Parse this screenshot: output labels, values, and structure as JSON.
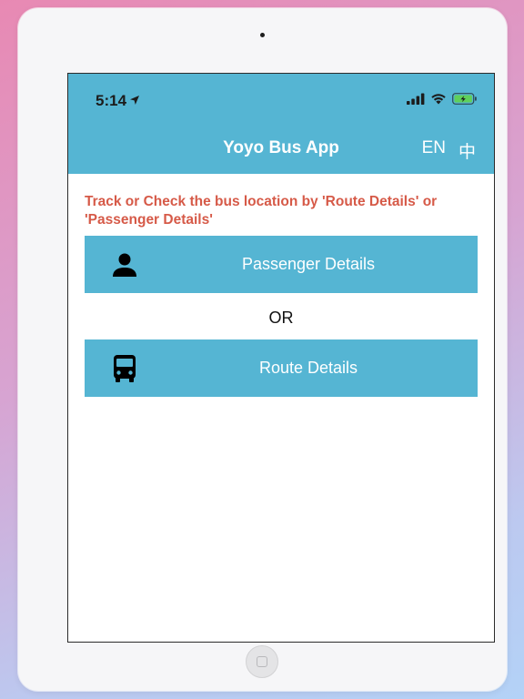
{
  "status_bar": {
    "time": "5:14",
    "location_icon": "location-arrow-icon",
    "signal_icon": "cellular-signal-icon",
    "wifi_icon": "wifi-icon",
    "battery_icon": "battery-charging-icon"
  },
  "header": {
    "title": "Yoyo Bus App",
    "lang_en": "EN",
    "lang_zh": "中",
    "background_color": "#55b5d3"
  },
  "main": {
    "instruction": "Track or Check the bus location by 'Route Details' or 'Passenger Details'",
    "instruction_color": "#d65a48",
    "passenger_button": {
      "label": "Passenger Details",
      "icon": "person-icon"
    },
    "separator": "OR",
    "route_button": {
      "label": "Route Details",
      "icon": "bus-icon"
    }
  }
}
